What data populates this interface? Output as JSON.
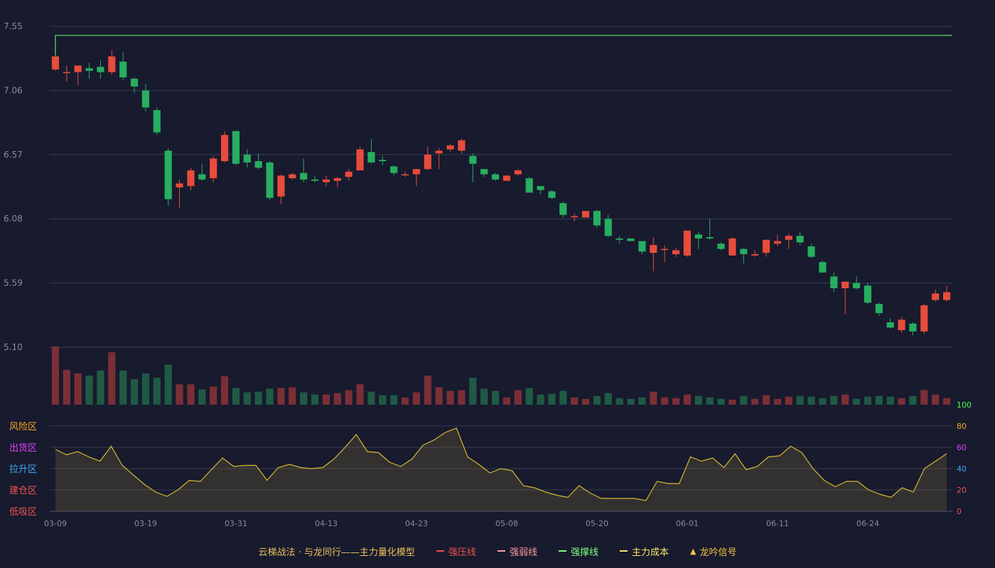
{
  "chart_data": [
    {
      "type": "candlestick",
      "title": "",
      "y_ticks": [
        "7.55",
        "7.06",
        "6.57",
        "6.08",
        "5.59",
        "5.10"
      ],
      "ylim": [
        5.1,
        7.55
      ],
      "x_ticks": [
        "03-09",
        "03-19",
        "03-31",
        "04-13",
        "04-23",
        "05-08",
        "05-20",
        "06-01",
        "06-11",
        "06-24"
      ],
      "reference_lines": [
        {
          "name": "强撑线",
          "value": 7.48
        }
      ],
      "candles": [
        [
          7.22,
          7.32,
          7.33,
          7.21
        ],
        [
          7.2,
          7.2,
          7.25,
          7.13
        ],
        [
          7.2,
          7.25,
          7.25,
          7.1
        ],
        [
          7.23,
          7.21,
          7.27,
          7.15
        ],
        [
          7.24,
          7.2,
          7.29,
          7.15
        ],
        [
          7.2,
          7.32,
          7.37,
          7.18
        ],
        [
          7.28,
          7.16,
          7.35,
          7.14
        ],
        [
          7.15,
          7.09,
          7.16,
          7.04
        ],
        [
          7.06,
          6.93,
          7.11,
          6.9
        ],
        [
          6.91,
          6.74,
          6.93,
          6.72
        ],
        [
          6.6,
          6.23,
          6.62,
          6.18
        ],
        [
          6.32,
          6.35,
          6.38,
          6.16
        ],
        [
          6.33,
          6.45,
          6.47,
          6.3
        ],
        [
          6.42,
          6.38,
          6.5,
          6.37
        ],
        [
          6.39,
          6.54,
          6.56,
          6.36
        ],
        [
          6.52,
          6.72,
          6.75,
          6.51
        ],
        [
          6.75,
          6.5,
          6.75,
          6.49
        ],
        [
          6.57,
          6.51,
          6.61,
          6.47
        ],
        [
          6.52,
          6.47,
          6.58,
          6.46
        ],
        [
          6.51,
          6.24,
          6.52,
          6.22
        ],
        [
          6.25,
          6.41,
          6.42,
          6.19
        ],
        [
          6.39,
          6.42,
          6.43,
          6.38
        ],
        [
          6.43,
          6.38,
          6.54,
          6.36
        ],
        [
          6.38,
          6.37,
          6.41,
          6.36
        ],
        [
          6.36,
          6.38,
          6.41,
          6.33
        ],
        [
          6.37,
          6.39,
          6.4,
          6.32
        ],
        [
          6.4,
          6.44,
          6.46,
          6.37
        ],
        [
          6.45,
          6.61,
          6.63,
          6.45
        ],
        [
          6.59,
          6.51,
          6.69,
          6.5
        ],
        [
          6.53,
          6.52,
          6.56,
          6.49
        ],
        [
          6.48,
          6.43,
          6.49,
          6.41
        ],
        [
          6.42,
          6.42,
          6.44,
          6.4
        ],
        [
          6.42,
          6.46,
          6.46,
          6.33
        ],
        [
          6.46,
          6.57,
          6.63,
          6.45
        ],
        [
          6.58,
          6.6,
          6.62,
          6.46
        ],
        [
          6.61,
          6.64,
          6.65,
          6.59
        ],
        [
          6.6,
          6.68,
          6.69,
          6.58
        ],
        [
          6.56,
          6.5,
          6.58,
          6.36
        ],
        [
          6.46,
          6.42,
          6.46,
          6.4
        ],
        [
          6.42,
          6.38,
          6.43,
          6.37
        ],
        [
          6.37,
          6.41,
          6.41,
          6.38
        ],
        [
          6.42,
          6.45,
          6.46,
          6.41
        ],
        [
          6.39,
          6.28,
          6.4,
          6.28
        ],
        [
          6.33,
          6.3,
          6.33,
          6.27
        ],
        [
          6.29,
          6.24,
          6.3,
          6.23
        ],
        [
          6.2,
          6.11,
          6.21,
          6.09
        ],
        [
          6.1,
          6.1,
          6.12,
          6.06
        ],
        [
          6.09,
          6.14,
          6.14,
          6.09
        ],
        [
          6.14,
          6.03,
          6.15,
          6.01
        ],
        [
          6.08,
          5.95,
          6.11,
          5.94
        ],
        [
          5.93,
          5.92,
          5.95,
          5.89
        ],
        [
          5.93,
          5.91,
          5.93,
          5.91
        ],
        [
          5.91,
          5.83,
          5.91,
          5.81
        ],
        [
          5.82,
          5.88,
          5.94,
          5.68
        ],
        [
          5.85,
          5.85,
          5.88,
          5.75
        ],
        [
          5.81,
          5.84,
          5.86,
          5.79
        ],
        [
          5.8,
          5.99,
          5.99,
          5.79
        ],
        [
          5.96,
          5.93,
          5.98,
          5.85
        ],
        [
          5.94,
          5.93,
          6.08,
          5.92
        ],
        [
          5.89,
          5.85,
          5.9,
          5.84
        ],
        [
          5.8,
          5.93,
          5.94,
          5.8
        ],
        [
          5.85,
          5.81,
          5.86,
          5.74
        ],
        [
          5.8,
          5.81,
          5.84,
          5.79
        ],
        [
          5.82,
          5.92,
          5.92,
          5.79
        ],
        [
          5.89,
          5.91,
          5.96,
          5.87
        ],
        [
          5.92,
          5.95,
          5.97,
          5.85
        ],
        [
          5.95,
          5.9,
          5.98,
          5.88
        ],
        [
          5.87,
          5.79,
          5.89,
          5.78
        ],
        [
          5.75,
          5.67,
          5.76,
          5.67
        ],
        [
          5.64,
          5.55,
          5.67,
          5.52
        ],
        [
          5.55,
          5.6,
          5.6,
          5.35
        ],
        [
          5.59,
          5.55,
          5.64,
          5.54
        ],
        [
          5.57,
          5.44,
          5.59,
          5.43
        ],
        [
          5.43,
          5.36,
          5.44,
          5.34
        ],
        [
          5.29,
          5.25,
          5.32,
          5.24
        ],
        [
          5.23,
          5.31,
          5.33,
          5.21
        ],
        [
          5.28,
          5.22,
          5.29,
          5.19
        ],
        [
          5.22,
          5.42,
          5.43,
          5.2
        ],
        [
          5.46,
          5.51,
          5.54,
          5.45
        ],
        [
          5.46,
          5.52,
          5.57,
          5.45
        ]
      ],
      "volume": [
        80,
        48,
        43,
        40,
        47,
        72,
        47,
        35,
        43,
        37,
        55,
        28,
        28,
        21,
        25,
        39,
        23,
        17,
        18,
        22,
        23,
        24,
        17,
        14,
        14,
        16,
        20,
        28,
        18,
        13,
        13,
        10,
        17,
        40,
        24,
        19,
        20,
        37,
        22,
        19,
        10,
        20,
        23,
        14,
        15,
        19,
        10,
        8,
        12,
        16,
        9,
        8,
        10,
        18,
        10,
        9,
        14,
        12,
        10,
        8,
        7,
        12,
        8,
        13,
        8,
        11,
        12,
        11,
        9,
        12,
        14,
        8,
        11,
        12,
        11,
        9,
        12,
        20,
        14,
        9
      ],
      "up_color": "#e74c3c",
      "down_color": "#27ae60"
    },
    {
      "type": "area",
      "y_ticks": [
        "100",
        "80",
        "60",
        "40",
        "20",
        "0"
      ],
      "ylim": [
        0,
        100
      ],
      "zones": [
        {
          "label": "风险区",
          "color": "#f5a623"
        },
        {
          "label": "出货区",
          "color": "#e040fb"
        },
        {
          "label": "拉升区",
          "color": "#42a5f5"
        },
        {
          "label": "建仓区",
          "color": "#ef5350"
        },
        {
          "label": "低吸区",
          "color": "#ef5350"
        }
      ],
      "tick_colors": [
        "#4cff4c",
        "#f5a623",
        "#e040fb",
        "#42a5f5",
        "#ef5350",
        "#ef5350"
      ],
      "values": [
        58,
        53,
        56,
        51,
        47,
        61,
        43,
        34,
        25,
        18,
        14,
        20,
        29,
        28,
        39,
        50,
        42,
        43,
        43,
        29,
        41,
        44,
        41,
        40,
        41,
        49,
        60,
        72,
        56,
        55,
        46,
        42,
        49,
        62,
        67,
        74,
        78,
        51,
        44,
        36,
        40,
        38,
        24,
        22,
        18,
        15,
        13,
        24,
        17,
        12,
        12,
        12,
        12,
        10,
        28,
        26,
        26,
        51,
        47,
        50,
        41,
        54,
        39,
        42,
        51,
        52,
        61,
        55,
        40,
        29,
        23,
        28,
        28,
        20,
        16,
        13,
        22,
        18,
        40,
        47,
        54
      ],
      "line_color": "#d4b830"
    }
  ],
  "legend": {
    "title": "云梯战法 · 与龙同行——主力量化模型",
    "items": [
      {
        "label": "强压线",
        "color": "#ef5350",
        "style": "solid"
      },
      {
        "label": "强弱线",
        "color": "#ff9aa2",
        "style": "dashed"
      },
      {
        "label": "强撑线",
        "color": "#7dff7d",
        "style": "solid"
      },
      {
        "label": "主力成本",
        "color": "#ffe566",
        "style": "dashed"
      },
      {
        "label": "龙吟信号",
        "color": "#f5c242",
        "symbol": "▲"
      }
    ]
  }
}
